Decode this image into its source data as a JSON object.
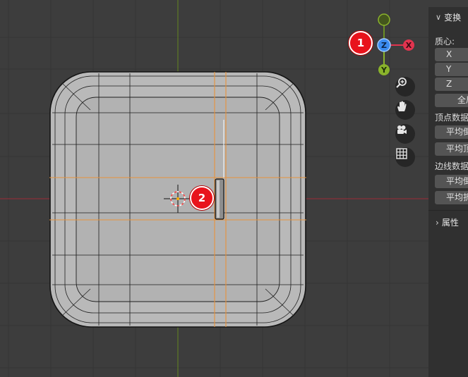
{
  "viewport": {
    "gizmo": {
      "x_label": "X",
      "y_label": "Y",
      "z_label": "Z"
    },
    "nav_buttons": [
      {
        "icon": "zoom-magnifier-icon"
      },
      {
        "icon": "pan-hand-icon"
      },
      {
        "icon": "camera-icon"
      },
      {
        "icon": "grid-icon"
      }
    ],
    "badges": {
      "one": "1",
      "two": "2"
    },
    "colors": {
      "x_axis": "#e2344f",
      "y_axis": "#8ab32b",
      "z_axis": "#3b8cf0",
      "selected_edge": "#e8923a",
      "mesh": "#b4b4b4"
    }
  },
  "panel": {
    "transform_title": "变换",
    "median_label": "质心:",
    "fields": {
      "x": "X",
      "y": "Y",
      "z": "Z"
    },
    "global_button": "全局",
    "vertex_data_label": "顶点数据:",
    "vertex_bevel_weight": "平均倒角权重",
    "vertex_crease": "平均顶点折痕",
    "edge_data_label": "边线数据:",
    "edge_bevel_weight": "平均倒角权重",
    "edge_crease": "平均折痕",
    "properties_title": "属性"
  }
}
